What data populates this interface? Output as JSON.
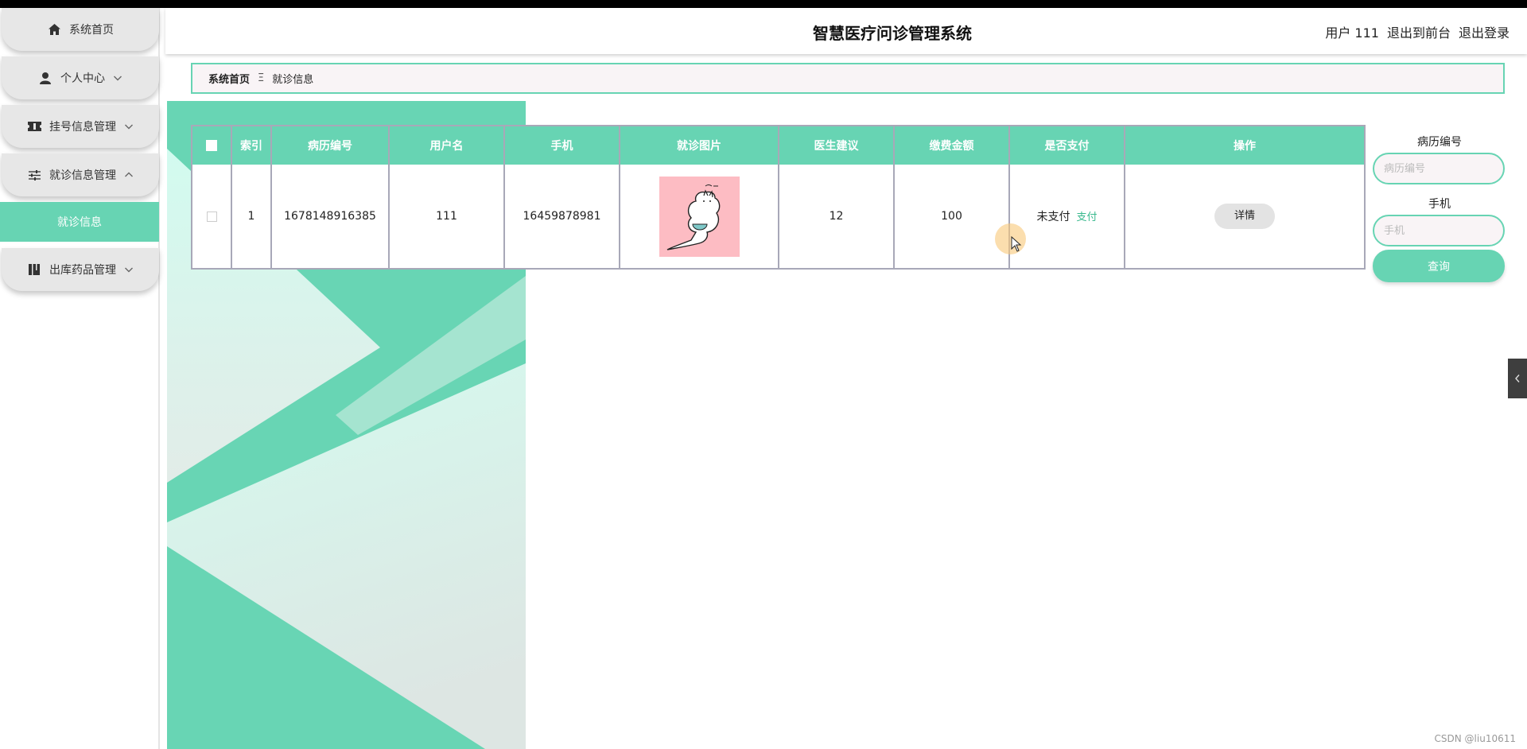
{
  "header": {
    "title": "智慧医疗问诊管理系统",
    "user_label": "用户 111",
    "exit_front_label": "退出到前台",
    "logout_label": "退出登录"
  },
  "sidebar": {
    "items": [
      {
        "label": "系统首页",
        "icon": "home-icon"
      },
      {
        "label": "个人中心",
        "icon": "user-icon"
      },
      {
        "label": "挂号信息管理",
        "icon": "ticket-icon"
      },
      {
        "label": "就诊信息管理",
        "icon": "sliders-icon"
      },
      {
        "label": "出库药品管理",
        "icon": "book-icon"
      }
    ],
    "active_sub": "就诊信息"
  },
  "breadcrumb": {
    "home": "系统首页",
    "separator": "Ξ",
    "current": "就诊信息"
  },
  "table": {
    "columns": [
      "索引",
      "病历编号",
      "用户名",
      "手机",
      "就诊图片",
      "医生建议",
      "缴费金额",
      "是否支付",
      "操作"
    ],
    "rows": [
      {
        "index": "1",
        "record_no": "1678148916385",
        "username": "111",
        "phone": "16459878981",
        "advice": "12",
        "amount": "100",
        "pay_status": "未支付",
        "pay_link": "支付",
        "detail": "详情"
      }
    ]
  },
  "search": {
    "record_label": "病历编号",
    "record_placeholder": "病历编号",
    "phone_label": "手机",
    "phone_placeholder": "手机",
    "query_label": "查询"
  },
  "watermark": "CSDN @liu10611",
  "colors": {
    "accent": "#67d4b3",
    "menu_bg": "#e7e7e7",
    "breadcrumb_bg": "#f9f4f6"
  }
}
